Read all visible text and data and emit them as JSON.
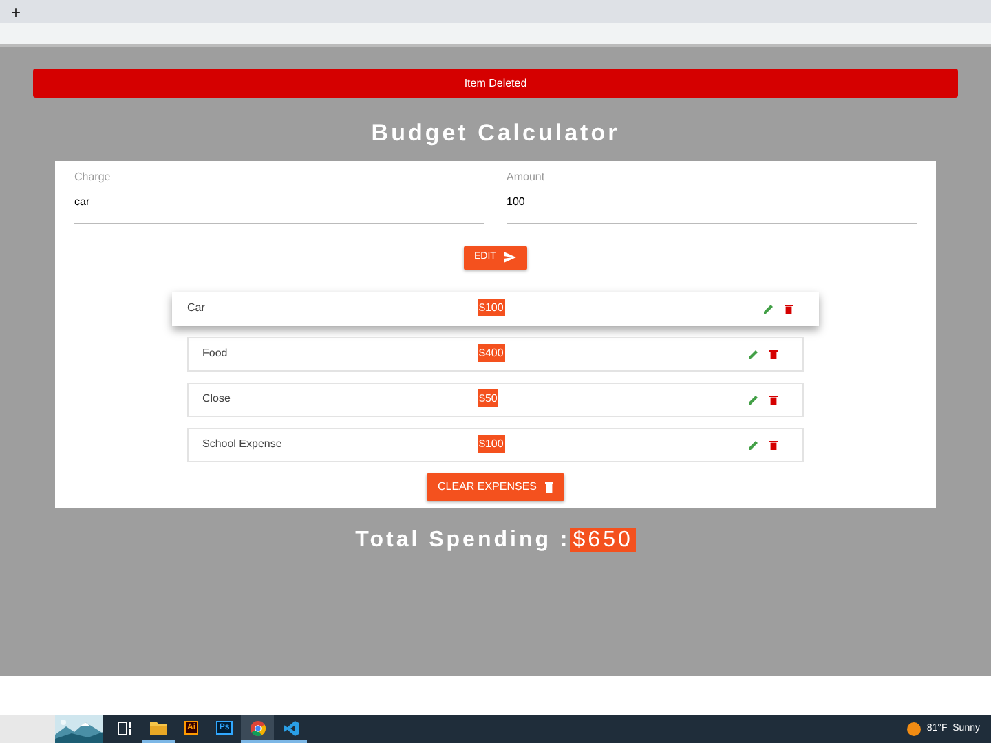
{
  "browser": {
    "new_tab": "+"
  },
  "alert": {
    "text": "Item Deleted"
  },
  "title": "Budget Calculator",
  "form": {
    "charge": {
      "label": "Charge",
      "value": "car"
    },
    "amount": {
      "label": "Amount",
      "value": "100"
    },
    "submit": "EDIT"
  },
  "expenses": [
    {
      "charge": "Car",
      "amount": "$100",
      "raised": true
    },
    {
      "charge": "Food",
      "amount": "$400",
      "raised": false
    },
    {
      "charge": "Close",
      "amount": "$50",
      "raised": false
    },
    {
      "charge": "School Expense",
      "amount": "$100",
      "raised": false
    }
  ],
  "clear_button": "CLEAR EXPENSES",
  "total": {
    "label": "Total Spending :",
    "amount": "$650"
  },
  "taskbar": {
    "apps": [
      {
        "kind": "taskview",
        "running": false,
        "selected": false
      },
      {
        "kind": "folder",
        "running": true,
        "selected": false
      },
      {
        "kind": "ai",
        "label": "Ai",
        "running": false,
        "selected": false
      },
      {
        "kind": "ps",
        "label": "Ps",
        "running": false,
        "selected": false
      },
      {
        "kind": "chrome",
        "running": true,
        "selected": true
      },
      {
        "kind": "vscode",
        "running": true,
        "selected": false
      }
    ],
    "weather": "81°F  Sunny"
  }
}
